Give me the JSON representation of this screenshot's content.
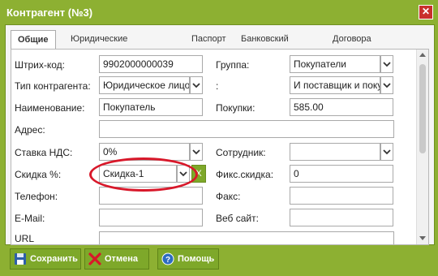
{
  "window": {
    "title": "Контрагент (№3)",
    "close": "✕"
  },
  "tabs": [
    "Общие",
    "Юридические реквизиты",
    "Паспорт",
    "Банковский счет",
    "Договора"
  ],
  "form": {
    "barcode_label": "Штрих-код:",
    "barcode_value": "9902000000039",
    "group_label": "Группа:",
    "group_value": "Покупатели",
    "type_label": "Тип контрагента:",
    "type_value": "Юридическое лицо",
    "role_label": ":",
    "role_value": "И поставщик и покупатель",
    "name_label": "Наименование:",
    "name_value": "Покупатель",
    "purchases_label": "Покупки:",
    "purchases_value": "585.00",
    "address_label": "Адрес:",
    "address_value": "",
    "vat_label": "Ставка НДС:",
    "vat_value": "0%",
    "employee_label": "Сотрудник:",
    "employee_value": "",
    "discount_label": "Скидка %:",
    "discount_value": "Скидка-1",
    "discount_clear": "X",
    "fixed_discount_label": "Фикс.скидка:",
    "fixed_discount_value": "0",
    "phone_label": "Телефон:",
    "phone_value": "",
    "fax_label": "Факс:",
    "fax_value": "",
    "email_label": "E-Mail:",
    "email_value": "",
    "website_label": "Веб сайт:",
    "website_value": "",
    "url_label": "URL",
    "url_value": ""
  },
  "footer": {
    "save": "Сохранить",
    "cancel": "Отмена",
    "help": "Помощь"
  },
  "colors": {
    "accent": "#8db032",
    "highlight": "#d8182a"
  }
}
